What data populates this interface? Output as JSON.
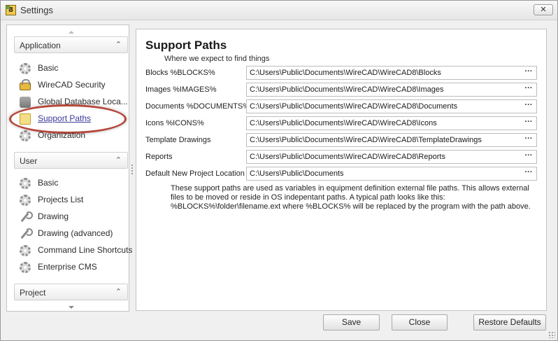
{
  "window": {
    "title": "Settings",
    "icon": "app-icon",
    "close_label": "✕"
  },
  "sidebar": {
    "groups": [
      {
        "title": "Application",
        "items": [
          {
            "label": "Basic",
            "icon": "gear-icon"
          },
          {
            "label": "WireCAD Security",
            "icon": "lock-icon"
          },
          {
            "label": "Global Database Loca...",
            "icon": "database-icon"
          },
          {
            "label": "Support Paths",
            "icon": "folder-icon",
            "selected": true
          },
          {
            "label": "Organization",
            "icon": "gear-icon"
          }
        ]
      },
      {
        "title": "User",
        "items": [
          {
            "label": "Basic",
            "icon": "gear-icon"
          },
          {
            "label": "Projects List",
            "icon": "gear-icon"
          },
          {
            "label": "Drawing",
            "icon": "wrench-icon"
          },
          {
            "label": "Drawing (advanced)",
            "icon": "wrench-icon"
          },
          {
            "label": "Command Line Shortcuts",
            "icon": "gear-icon"
          },
          {
            "label": "Enterprise CMS",
            "icon": "gear-icon"
          }
        ]
      },
      {
        "title": "Project",
        "items": []
      }
    ]
  },
  "content": {
    "title": "Support Paths",
    "subtitle": "Where we expect to find things",
    "paths": [
      {
        "label": "Blocks %BLOCKS%",
        "value": "C:\\Users\\Public\\Documents\\WireCAD\\WireCAD8\\Blocks"
      },
      {
        "label": "Images %IMAGES%",
        "value": "C:\\Users\\Public\\Documents\\WireCAD\\WireCAD8\\Images"
      },
      {
        "label": "Documents %DOCUMENTS%",
        "value": "C:\\Users\\Public\\Documents\\WireCAD\\WireCAD8\\Documents"
      },
      {
        "label": "Icons %ICONS%",
        "value": "C:\\Users\\Public\\Documents\\WireCAD\\WireCAD8\\Icons"
      },
      {
        "label": "Template Drawings",
        "value": "C:\\Users\\Public\\Documents\\WireCAD\\WireCAD8\\TemplateDrawings"
      },
      {
        "label": "Reports",
        "value": "C:\\Users\\Public\\Documents\\WireCAD\\WireCAD8\\Reports"
      },
      {
        "label": "Default New Project Location",
        "value": "C:\\Users\\Public\\Documents"
      }
    ],
    "browse_label": "···",
    "note": "These support paths are used as variables in equipment definition external file paths. This allows external files to be moved or reside in OS indepentant paths. A typical path looks like this: %BLOCKS%\\folder\\filename.ext where %BLOCKS% will be replaced by the program with the path above."
  },
  "buttons": {
    "save": "Save",
    "close": "Close",
    "restore": "Restore Defaults"
  },
  "colors": {
    "highlight_ring": "#b5473a",
    "selected_link": "#3a3a9a"
  }
}
